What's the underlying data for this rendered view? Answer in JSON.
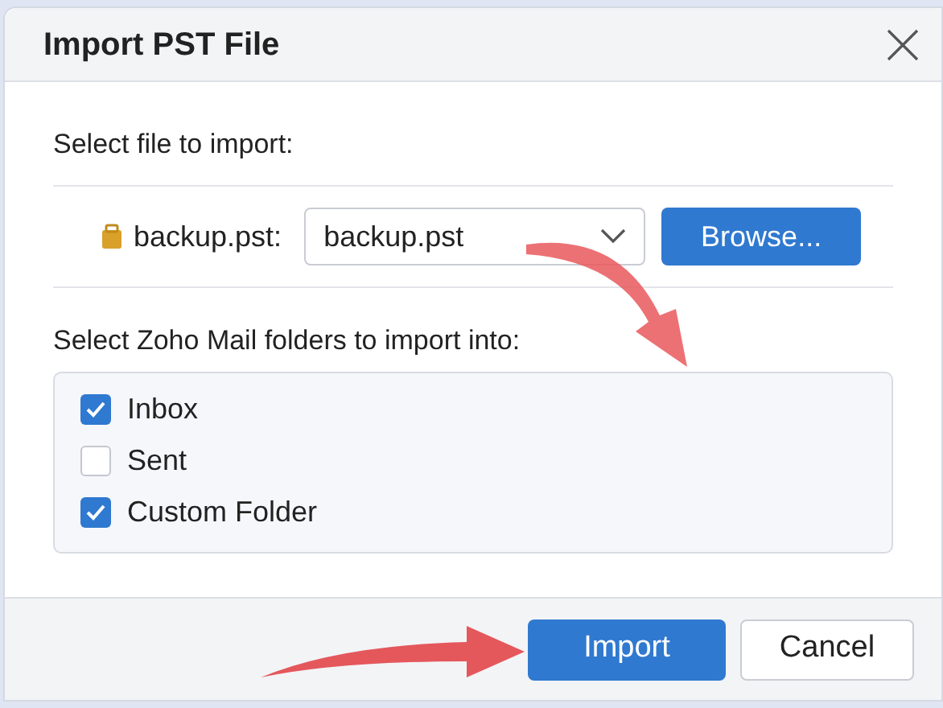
{
  "window": {
    "title": "Import PST File"
  },
  "file_section": {
    "heading": "Select file to import:",
    "file_label": "backup.pst:",
    "file_select": {
      "value": "backup.pst"
    },
    "browse_button": "Browse..."
  },
  "folders_section": {
    "heading": "Select Zoho Mail folders to import into:",
    "folders": [
      {
        "label": "Inbox",
        "checked": true
      },
      {
        "label": "Sent",
        "checked": false
      },
      {
        "label": "Custom Folder",
        "checked": true
      }
    ]
  },
  "buttons": [
    {
      "label": "Import",
      "kind": "primary"
    },
    {
      "label": "Cancel",
      "kind": "secondary"
    }
  ]
}
